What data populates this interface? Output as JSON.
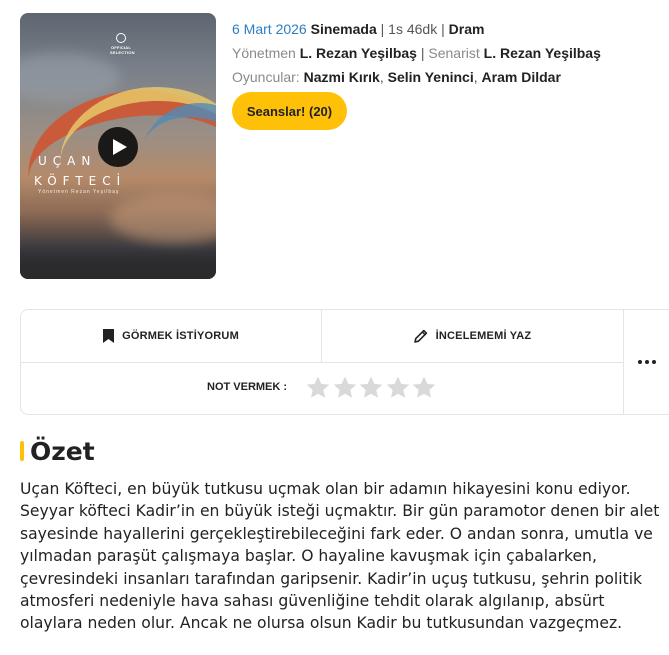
{
  "poster": {
    "logo_text": "OFFICIAL SELECTION",
    "title_line1": "UÇAN",
    "title_line2": "KÖFTECİ",
    "credit": "Yönetmen Rezan Yeşilbaş",
    "play_icon": "play-icon"
  },
  "info": {
    "date": "6 Mart 2026",
    "status": "Sinemada",
    "duration": "1s 46dk",
    "genre": "Dram",
    "director_label": "Yönetmen",
    "director": "L. Rezan Yeşilbaş",
    "writer_label": "Senarist",
    "writer": "L. Rezan Yeşilbaş",
    "cast_label": "Oyuncular:",
    "cast": [
      "Nazmi Kırık",
      "Selin Yeninci",
      "Aram Dildar"
    ]
  },
  "sessions_button": "Seanslar! (20)",
  "actions": {
    "watchlist_label": "GÖRMEK İSTİYORUM",
    "watchlist_icon": "bookmark-icon",
    "review_label": "İNCELEMEMİ YAZ",
    "review_icon": "pencil-icon",
    "rate_label": "NOT VERMEK :",
    "rating": 0,
    "max_rating": 5,
    "more_icon": "more-horizontal-icon"
  },
  "summary": {
    "title": "Özet",
    "text": "Uçan Köfteci, en büyük tutkusu uçmak olan bir adamın hikayesini konu ediyor. Seyyar köfteci Kadir’in en büyük isteği uçmaktır. Bir gün paramotor  denen bir alet sayesinde hayallerini gerçekleştirebileceğini fark eder. O andan sonra, umutla ve yılmadan paraşüt çalışmaya başlar. O hayaline kavuşmak için çabalarken, çevresindeki insanları tarafından garipsenir. Kadir’in uçuş tutkusu, şehrin politik atmosferi nedeniyle hava sahası güvenliğine tehdit olarak algılanıp, absürt olaylara neden olur. Ancak ne olursa olsun Kadir bu tutkusundan vazgeçmez."
  },
  "colors": {
    "accent": "#ffc107",
    "link_blue": "#2a7fc4",
    "star_empty": "#d9d9d9"
  }
}
